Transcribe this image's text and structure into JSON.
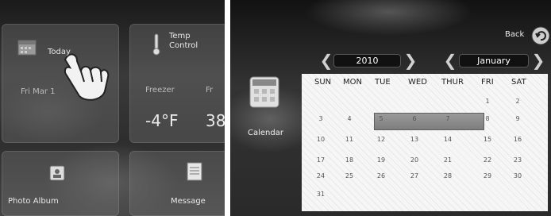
{
  "home": {
    "today_label": "Today",
    "date_text": "Fri Mar 1",
    "temp_control_line1": "Temp",
    "temp_control_line2": "Control",
    "freezer_label": "Freezer",
    "fridge_label_partial": "Fr",
    "freezer_temp": "-4°F",
    "fridge_temp_partial": "38",
    "photo_album_label": "Photo Album",
    "message_label": "Message"
  },
  "calendar": {
    "back_label": "Back",
    "calendar_label": "Calendar",
    "year": "2010",
    "month": "January",
    "days_of_week": [
      "SUN",
      "MON",
      "TUE",
      "WED",
      "THUR",
      "FRI",
      "SAT"
    ],
    "weeks": [
      [
        "",
        "",
        "",
        "",
        "",
        "1",
        "2"
      ],
      [
        "3",
        "4",
        "5",
        "6",
        "7",
        "8",
        "9"
      ],
      [
        "10",
        "11",
        "12",
        "13",
        "14",
        "15",
        "16"
      ],
      [
        "17",
        "18",
        "19",
        "20",
        "21",
        "22",
        "23"
      ],
      [
        "24",
        "25",
        "26",
        "27",
        "28",
        "29",
        "30"
      ],
      [
        "31",
        "",
        "",
        "",
        "",
        "",
        ""
      ]
    ]
  },
  "icons": {
    "today": "calendar-small-icon",
    "temp": "thermometer-icon",
    "photo": "photo-album-icon",
    "message": "message-icon",
    "calendar": "calendar-icon",
    "back": "back-arrow-icon",
    "hand": "hand-pointer-icon"
  }
}
